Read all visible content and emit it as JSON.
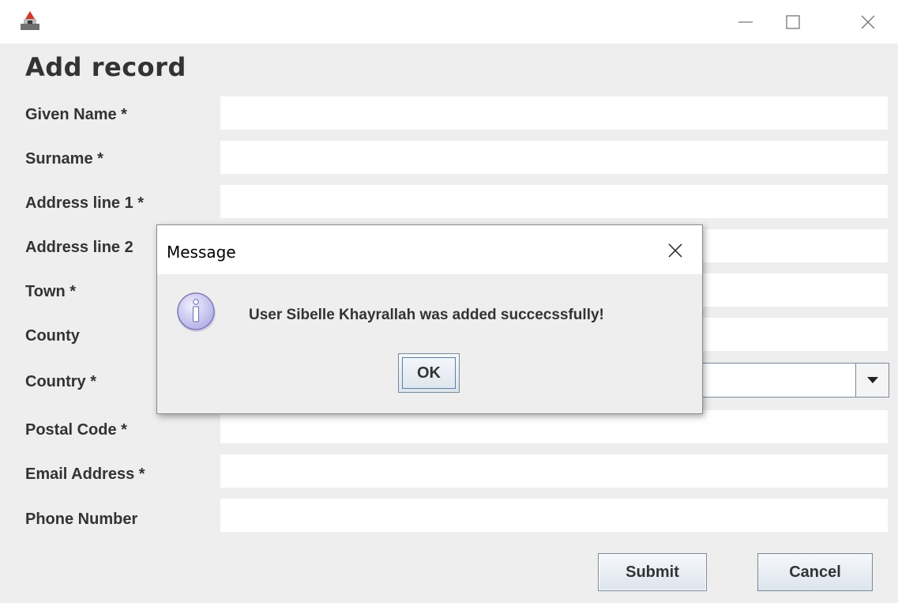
{
  "window": {
    "title": "",
    "controls": [
      "minimize-icon",
      "maximize-icon",
      "close-icon"
    ]
  },
  "form": {
    "title": "Add record",
    "fields": [
      {
        "label": "Given Name *",
        "value": ""
      },
      {
        "label": "Surname *",
        "value": ""
      },
      {
        "label": "Address line 1 *",
        "value": ""
      },
      {
        "label": "Address line 2",
        "value": ""
      },
      {
        "label": "Town *",
        "value": ""
      },
      {
        "label": "County",
        "value": ""
      },
      {
        "label": "Country *",
        "value": ""
      },
      {
        "label": "Postal Code *",
        "value": ""
      },
      {
        "label": "Email Address *",
        "value": ""
      },
      {
        "label": "Phone Number",
        "value": ""
      }
    ],
    "submit_label": "Submit",
    "cancel_label": "Cancel"
  },
  "dialog": {
    "title": "Message",
    "message": "User Sibelle Khayrallah was added succecssfully!",
    "ok_label": "OK",
    "icon": "info-icon"
  },
  "colors": {
    "background": "#eeeeee",
    "field": "#ffffff",
    "text": "#333333",
    "button_border": "#7a8a99",
    "info_icon": "#c9c6ef"
  }
}
